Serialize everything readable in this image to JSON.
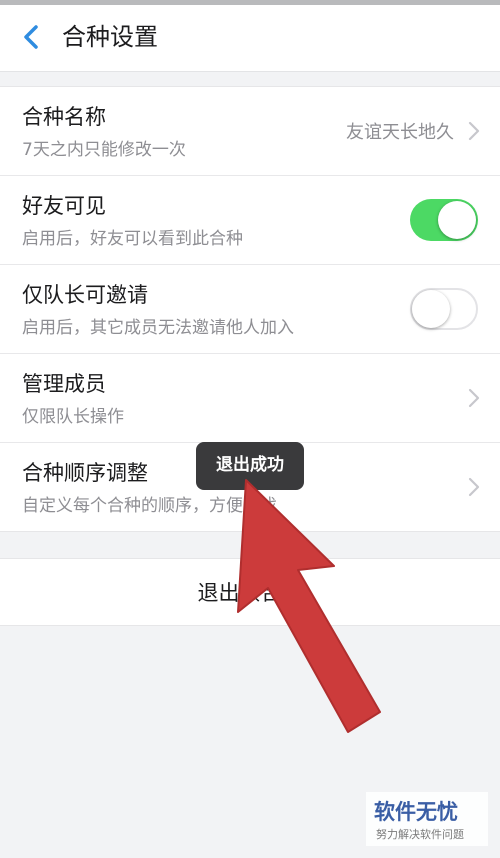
{
  "nav": {
    "title": "合种设置"
  },
  "rows": [
    {
      "title": "合种名称",
      "sub": "7天之内只能修改一次",
      "value": "友谊天长地久"
    },
    {
      "title": "好友可见",
      "sub": "启用后，好友可以看到此合种",
      "toggle": "on"
    },
    {
      "title": "仅队长可邀请",
      "sub": "启用后，其它成员无法邀请他人加入",
      "toggle": "off"
    },
    {
      "title": "管理成员",
      "sub": "仅限队长操作"
    },
    {
      "title": "合种顺序调整",
      "sub": "自定义每个合种的顺序，方便查找"
    }
  ],
  "exit_button": {
    "label": "退出该合种"
  },
  "toast": {
    "text": "退出成功"
  },
  "watermark": {
    "main": "软件无忧",
    "sub": "努力解决软件问题"
  },
  "colors": {
    "toggle_on": "#4cd964",
    "accent": "#2f8ce0",
    "arrow": "#cc3b3b"
  }
}
